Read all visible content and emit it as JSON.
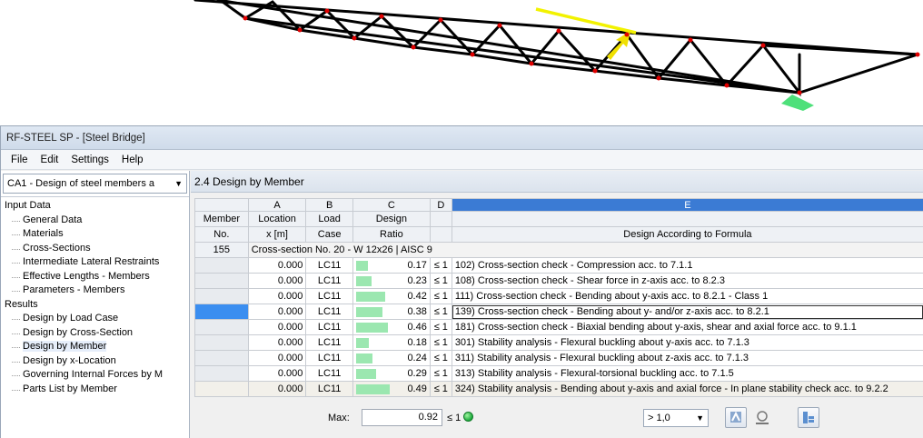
{
  "window": {
    "title": "RF-STEEL SP - [Steel Bridge]"
  },
  "menu": [
    "File",
    "Edit",
    "Settings",
    "Help"
  ],
  "case_selector": {
    "value": "CA1 - Design of steel members a"
  },
  "navigator": {
    "groups": [
      {
        "label": "Input Data",
        "items": [
          "General Data",
          "Materials",
          "Cross-Sections",
          "Intermediate Lateral Restraints",
          "Effective Lengths - Members",
          "Parameters - Members"
        ]
      },
      {
        "label": "Results",
        "items": [
          "Design by Load Case",
          "Design by Cross-Section",
          "Design by Member",
          "Design by x-Location",
          "Governing Internal Forces by M",
          "Parts List by Member"
        ]
      }
    ],
    "selected": "Design by Member"
  },
  "pane": {
    "title": "2.4 Design by Member"
  },
  "table": {
    "letters": [
      "A",
      "B",
      "C",
      "D",
      "E"
    ],
    "headers": {
      "member_no": [
        "Member",
        "No."
      ],
      "location": [
        "Location",
        "x [m]"
      ],
      "load_case": [
        "Load",
        "Case"
      ],
      "design_ratio": [
        "Design",
        "Ratio"
      ],
      "formula": "Design According to Formula"
    },
    "section_row": {
      "member": "155",
      "text": "Cross-section No.  20 - W 12x26 | AISC 9"
    },
    "rows": [
      {
        "x": "0.000",
        "lc": "LC11",
        "ratio": "0.17",
        "ratio_value": 0.17,
        "le": "≤ 1",
        "formula": "102) Cross-section check - Compression acc. to 7.1.1"
      },
      {
        "x": "0.000",
        "lc": "LC11",
        "ratio": "0.23",
        "ratio_value": 0.23,
        "le": "≤ 1",
        "formula": "108) Cross-section check - Shear force in z-axis acc. to 8.2.3"
      },
      {
        "x": "0.000",
        "lc": "LC11",
        "ratio": "0.42",
        "ratio_value": 0.42,
        "le": "≤ 1",
        "formula": "111) Cross-section check - Bending about y-axis acc. to 8.2.1 - Class 1"
      },
      {
        "x": "0.000",
        "lc": "LC11",
        "ratio": "0.38",
        "ratio_value": 0.38,
        "le": "≤ 1",
        "formula": "139) Cross-section check - Bending about y- and/or z-axis acc. to 8.2.1"
      },
      {
        "x": "0.000",
        "lc": "LC11",
        "ratio": "0.46",
        "ratio_value": 0.46,
        "le": "≤ 1",
        "formula": "181) Cross-section check - Biaxial bending about y-axis, shear and axial force acc. to 9.1.1"
      },
      {
        "x": "0.000",
        "lc": "LC11",
        "ratio": "0.18",
        "ratio_value": 0.18,
        "le": "≤ 1",
        "formula": "301) Stability analysis - Flexural buckling about y-axis acc. to 7.1.3"
      },
      {
        "x": "0.000",
        "lc": "LC11",
        "ratio": "0.24",
        "ratio_value": 0.24,
        "le": "≤ 1",
        "formula": "311) Stability analysis - Flexural buckling about z-axis acc. to 7.1.3"
      },
      {
        "x": "0.000",
        "lc": "LC11",
        "ratio": "0.29",
        "ratio_value": 0.29,
        "le": "≤ 1",
        "formula": "313) Stability analysis - Flexural-torsional buckling acc. to 7.1.5"
      },
      {
        "x": "0.000",
        "lc": "LC11",
        "ratio": "0.49",
        "ratio_value": 0.49,
        "le": "≤ 1",
        "formula": "324) Stability analysis - Bending about y-axis and axial force - In plane stability check acc. to 9.2.2"
      }
    ],
    "selected_row_index": 3
  },
  "footer": {
    "max_label": "Max:",
    "max_value": "0.92",
    "max_le": "≤ 1",
    "filter_value": "> 1,0"
  },
  "colors": {
    "ratio_bar": "#9be7b0",
    "selected_row": "#3b8ef0",
    "highlight_member": "#ffff00"
  }
}
